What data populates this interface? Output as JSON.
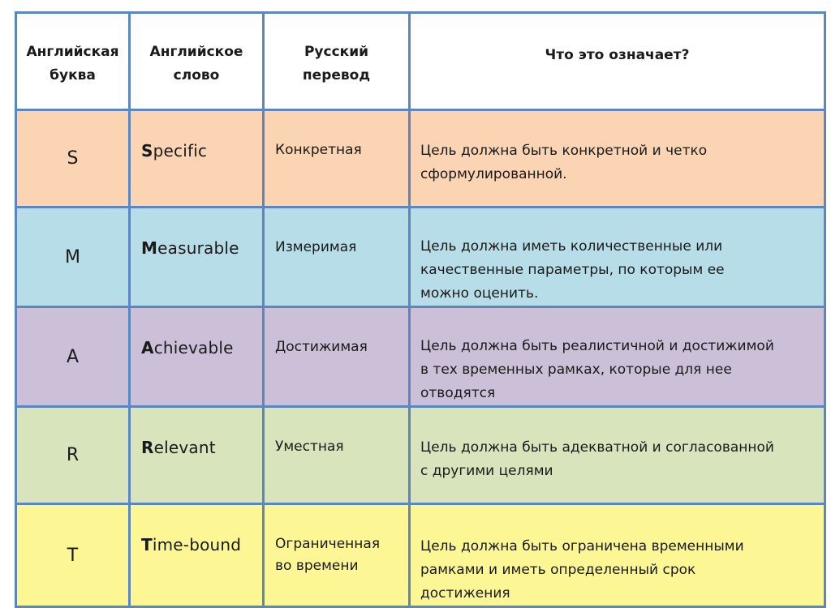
{
  "header": {
    "col_letter": [
      "Английская",
      "буква"
    ],
    "col_word": [
      "Английское",
      "слово"
    ],
    "col_translation": [
      "Русский",
      "перевод"
    ],
    "col_meaning": "Что это означает?"
  },
  "rows": [
    {
      "letter": "S",
      "word_initial": "S",
      "word_rest": "pecific",
      "translation": [
        "Конкретная"
      ],
      "meaning": [
        "Цель должна быть конкретной и четко",
        "сформулированной."
      ],
      "color": "#fbd4b4"
    },
    {
      "letter": "M",
      "word_initial": "M",
      "word_rest": "easurable",
      "translation": [
        "Измеримая"
      ],
      "meaning": [
        "Цель должна иметь  количественные или",
        "качественные  параметры, по которым ее",
        "можно оценить."
      ],
      "color": "#b7dde8"
    },
    {
      "letter": "A",
      "word_initial": "A",
      "word_rest": "chievable",
      "translation": [
        "Достижимая"
      ],
      "meaning": [
        "Цель должна быть реалистичной и достижимой",
        "в тех временных рамках, которые для нее",
        "отводятся"
      ],
      "color": "#ccc0d9"
    },
    {
      "letter": "R",
      "word_initial": "R",
      "word_rest": "elevant",
      "translation": [
        "Уместная"
      ],
      "meaning": [
        "Цель должна быть адекватной и согласованной",
        "с другими целями"
      ],
      "color": "#d7e4bc"
    },
    {
      "letter": "T",
      "word_initial": "T",
      "word_rest": "ime-bound",
      "translation": [
        "Ограниченная",
        "во времени"
      ],
      "meaning": [
        "Цель должна быть ограничена  временными",
        "рамками и иметь определенный срок",
        "достижения"
      ],
      "color": "#fcf794"
    }
  ],
  "colors": {
    "border": "#5b86c0",
    "header_bg": "#ffffff"
  }
}
